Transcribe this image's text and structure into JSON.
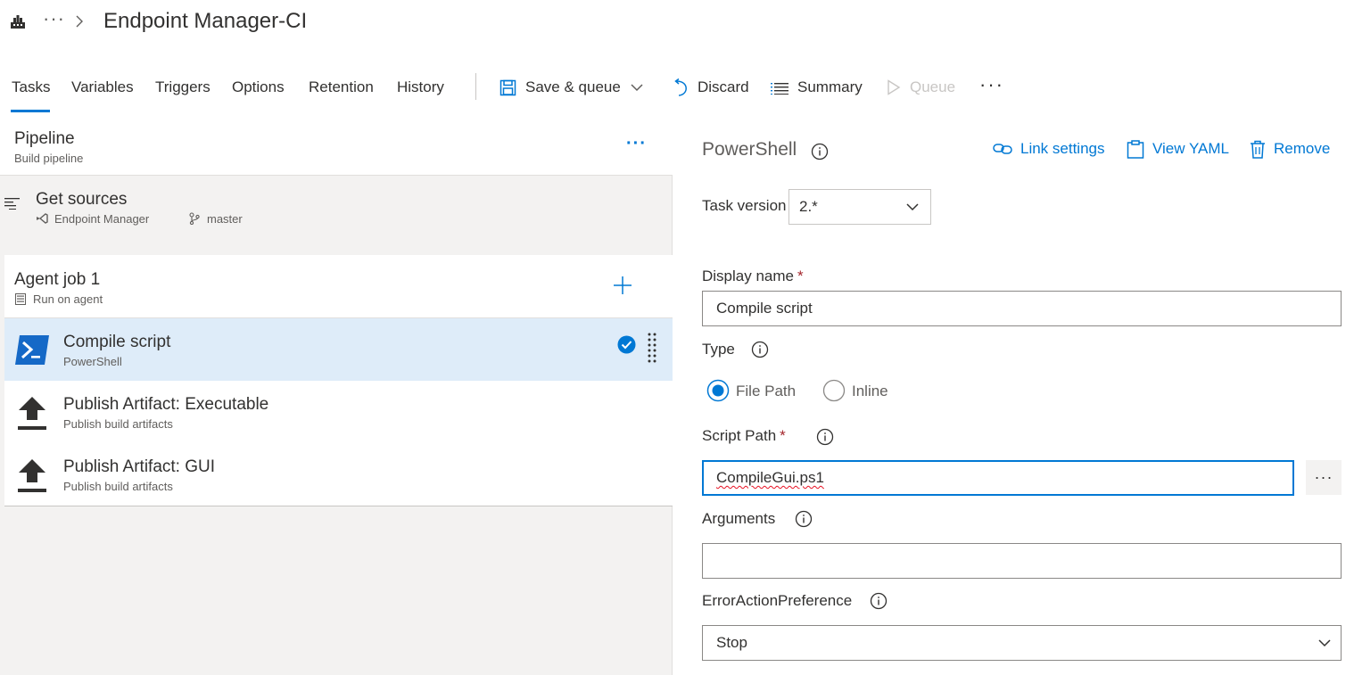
{
  "header": {
    "breadcrumb_more": "···",
    "title": "Endpoint Manager-CI"
  },
  "tabs": [
    {
      "label": "Tasks",
      "active": true
    },
    {
      "label": "Variables"
    },
    {
      "label": "Triggers"
    },
    {
      "label": "Options"
    },
    {
      "label": "Retention"
    },
    {
      "label": "History"
    }
  ],
  "toolbar": {
    "save_queue": "Save & queue",
    "discard": "Discard",
    "summary": "Summary",
    "queue": "Queue",
    "more": "···"
  },
  "pipeline": {
    "title": "Pipeline",
    "subtitle": "Build pipeline",
    "more": "···"
  },
  "get_sources": {
    "title": "Get sources",
    "repo": "Endpoint Manager",
    "branch": "master"
  },
  "agent_job": {
    "title": "Agent job 1",
    "subtitle": "Run on agent"
  },
  "tasks": [
    {
      "title": "Compile script",
      "subtitle": "PowerShell",
      "selected": true
    },
    {
      "title": "Publish Artifact: Executable",
      "subtitle": "Publish build artifacts"
    },
    {
      "title": "Publish Artifact: GUI",
      "subtitle": "Publish build artifacts"
    }
  ],
  "task_detail": {
    "title": "PowerShell",
    "link_settings": "Link settings",
    "view_yaml": "View YAML",
    "remove": "Remove",
    "task_version_label": "Task version",
    "task_version_value": "2.*",
    "display_name_label": "Display name",
    "display_name_value": "Compile script",
    "required_mark": "*",
    "type_label": "Type",
    "type_options": [
      "File Path",
      "Inline"
    ],
    "type_selected": "File Path",
    "script_path_label": "Script Path",
    "script_path_value": "CompileGui.ps1",
    "browse": "···",
    "arguments_label": "Arguments",
    "arguments_value": "",
    "error_action_label": "ErrorActionPreference",
    "error_action_value": "Stop"
  },
  "colors": {
    "accent": "#0078d4",
    "selected_row": "#deecf9",
    "pane_background": "#f3f2f1",
    "required": "#a4262c"
  }
}
